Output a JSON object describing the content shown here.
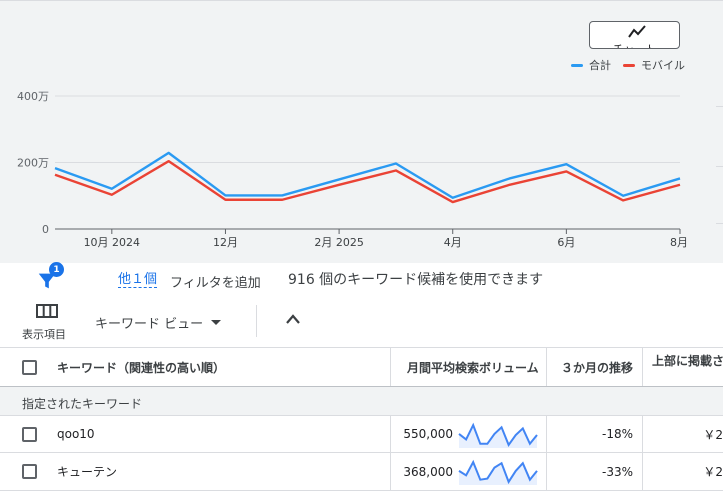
{
  "chart_button": {
    "label": "チャート",
    "icon": "trend-line-icon"
  },
  "legend": [
    {
      "name": "合計",
      "color": "#2a9af2"
    },
    {
      "name": "モバイル",
      "color": "#ea4335"
    }
  ],
  "chart_data": {
    "type": "line",
    "y_ticks": [
      "400万",
      "200万",
      "0"
    ],
    "y_tick_values": [
      4000000,
      2000000,
      0
    ],
    "ylim": [
      0,
      4000000
    ],
    "x_ticks": [
      "10月 2024",
      "12月",
      "2月 2025",
      "4月",
      "6月",
      "8月"
    ],
    "x_tick_index": [
      1,
      3,
      5,
      7,
      9,
      11
    ],
    "grid": "horizontal",
    "series": [
      {
        "name": "合計",
        "color": "#2a9af2",
        "values": [
          1830000,
          1210000,
          2290000,
          1010000,
          1010000,
          1490000,
          1970000,
          940000,
          1520000,
          1950000,
          1000000,
          1520000
        ]
      },
      {
        "name": "モバイル",
        "color": "#ea4335",
        "values": [
          1630000,
          1030000,
          2040000,
          880000,
          880000,
          1330000,
          1760000,
          810000,
          1330000,
          1730000,
          860000,
          1330000
        ]
      }
    ]
  },
  "toolbar": {
    "filter_badge": "1",
    "other_link": "他１個",
    "add_filter": "フィルタを追加",
    "count_message": "916 個のキーワード候補を使用できます",
    "columns_label": "表示項目",
    "view_dropdown": "キーワード ビュー",
    "accent_color": "#1a73e8"
  },
  "table": {
    "headers": {
      "keyword": "キーワード（関連性の高い順）",
      "volume": "月間平均検索ボリューム",
      "trend": "３か月の推移",
      "top": "上部に掲載さ"
    },
    "group_label": "指定されたキーワード",
    "rows": [
      {
        "keyword": "qoo10",
        "volume": "550,000",
        "trend": "-18%",
        "top": "￥2",
        "spark": [
          0.55,
          0.3,
          0.95,
          0.1,
          0.1,
          0.55,
          0.85,
          0.05,
          0.5,
          0.8,
          0.1,
          0.5
        ]
      },
      {
        "keyword": "キューテン",
        "volume": "368,000",
        "trend": "-33%",
        "top": "￥2",
        "spark": [
          0.55,
          0.35,
          0.95,
          0.15,
          0.2,
          0.7,
          0.9,
          0.05,
          0.55,
          0.9,
          0.15,
          0.55
        ]
      }
    ]
  }
}
